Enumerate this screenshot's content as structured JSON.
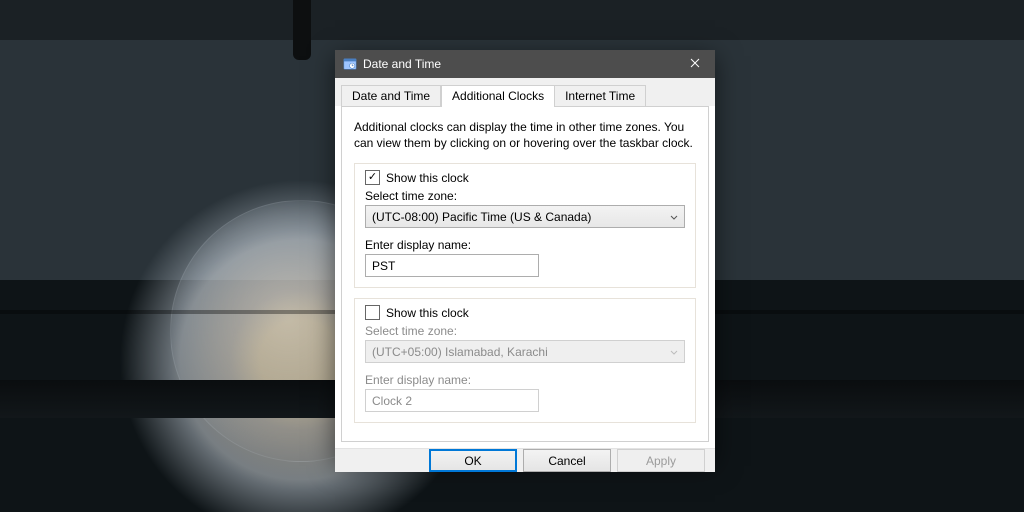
{
  "window": {
    "title": "Date and Time"
  },
  "tabs": [
    {
      "label": "Date and Time"
    },
    {
      "label": "Additional Clocks"
    },
    {
      "label": "Internet Time"
    }
  ],
  "page": {
    "description": "Additional clocks can display the time in other time zones. You can view them by clicking on or hovering over the taskbar clock."
  },
  "clock1": {
    "show_label": "Show this clock",
    "checked": true,
    "tz_label": "Select time zone:",
    "tz_value": "(UTC-08:00) Pacific Time (US & Canada)",
    "name_label": "Enter display name:",
    "name_value": "PST"
  },
  "clock2": {
    "show_label": "Show this clock",
    "checked": false,
    "tz_label": "Select time zone:",
    "tz_value": "(UTC+05:00) Islamabad, Karachi",
    "name_label": "Enter display name:",
    "name_value": "Clock 2"
  },
  "buttons": {
    "ok": "OK",
    "cancel": "Cancel",
    "apply": "Apply"
  }
}
